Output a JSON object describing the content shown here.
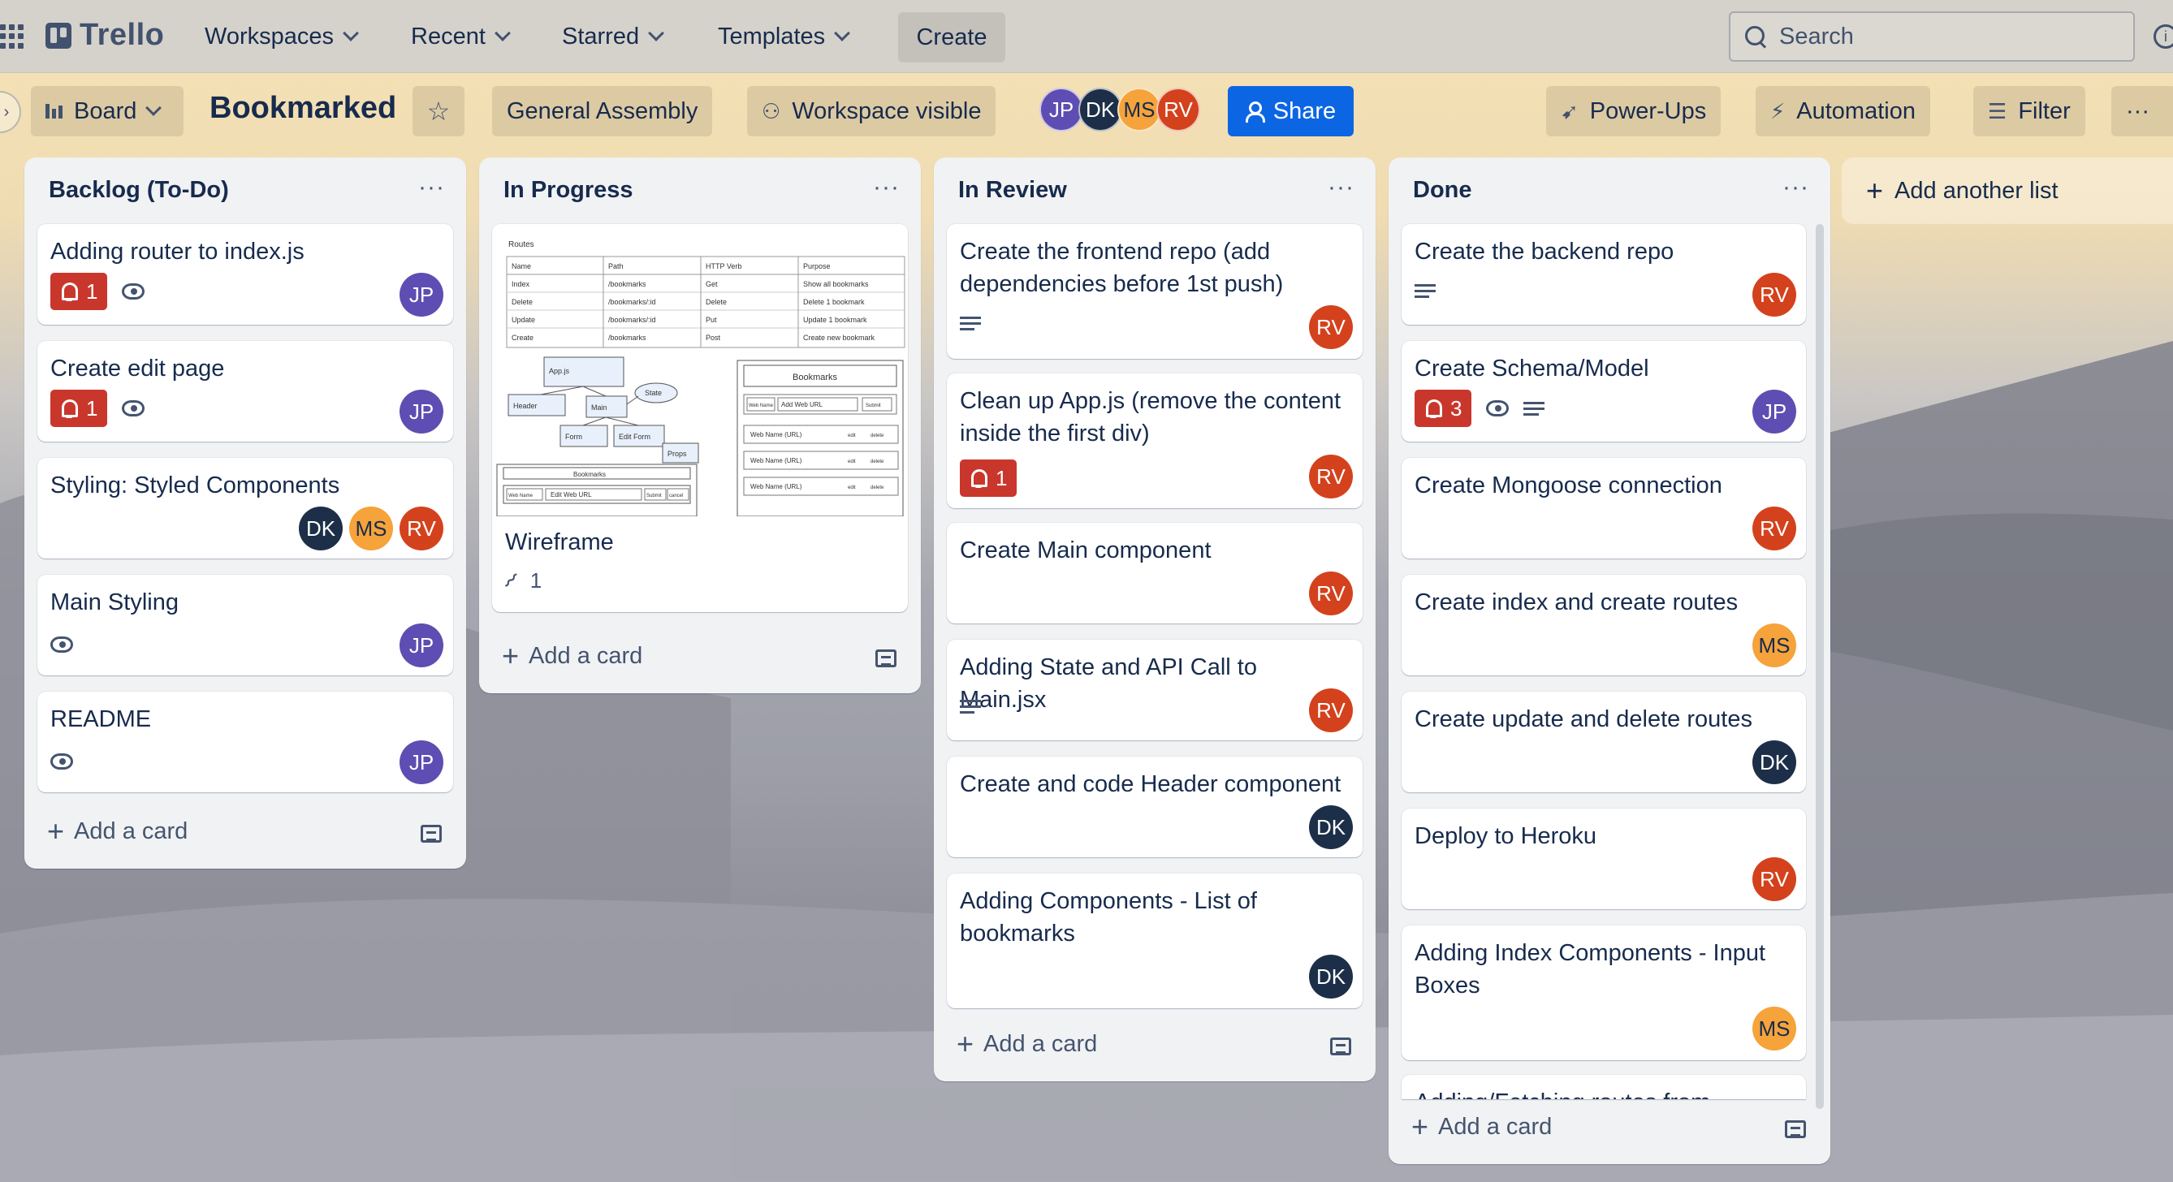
{
  "topnav": {
    "logo": "Trello",
    "items": [
      {
        "label": "Workspaces"
      },
      {
        "label": "Recent"
      },
      {
        "label": "Starred"
      },
      {
        "label": "Templates"
      }
    ],
    "create_label": "Create",
    "search_placeholder": "Search"
  },
  "board": {
    "view_label": "Board",
    "title": "Bookmarked",
    "workspace": "General Assembly",
    "visibility": "Workspace visible",
    "share_label": "Share",
    "powerups_label": "Power-Ups",
    "automation_label": "Automation",
    "filter_label": "Filter",
    "members": [
      "JP",
      "DK",
      "MS",
      "RV"
    ]
  },
  "colors": {
    "JP": "#5e4db2",
    "DK": "#1d2f48",
    "MS": "#f5a33a",
    "RV": "#d3421d",
    "accent": "#0c66e4",
    "alert": "#c9372c"
  },
  "lists": [
    {
      "title": "Backlog (To-Do)",
      "add_label": "Add a card",
      "cards": [
        {
          "title": "Adding router to index.js",
          "alert": "1",
          "watch": true,
          "members": [
            "JP"
          ]
        },
        {
          "title": "Create edit page",
          "alert": "1",
          "watch": true,
          "members": [
            "JP"
          ]
        },
        {
          "title": "Styling: Styled Components",
          "members": [
            "DK",
            "MS",
            "RV"
          ]
        },
        {
          "title": "Main Styling",
          "watch": true,
          "members": [
            "JP"
          ]
        },
        {
          "title": "README",
          "watch": true,
          "members": [
            "JP"
          ]
        }
      ]
    },
    {
      "title": "In Progress",
      "add_label": "Add a card",
      "cards": [
        {
          "title": "Wireframe",
          "attachments": "1",
          "cover": "wireframe"
        }
      ]
    },
    {
      "title": "In Review",
      "add_label": "Add a card",
      "cards": [
        {
          "title": "Create the frontend repo (add dependencies before 1st push)",
          "description": true,
          "members": [
            "RV"
          ]
        },
        {
          "title": "Clean up App.js (remove the content inside the first div)",
          "alert": "1",
          "members": [
            "RV"
          ]
        },
        {
          "title": "Create Main component",
          "members": [
            "RV"
          ]
        },
        {
          "title": "Adding State and API Call to Main.jsx",
          "description": true,
          "members": [
            "RV"
          ]
        },
        {
          "title": "Create and code Header component",
          "members": [
            "DK"
          ]
        },
        {
          "title": "Adding Components - List of bookmarks",
          "members": [
            "DK"
          ]
        }
      ]
    },
    {
      "title": "Done",
      "add_label": "Add a card",
      "cards": [
        {
          "title": "Create the backend repo",
          "description": true,
          "members": [
            "RV"
          ]
        },
        {
          "title": "Create Schema/Model",
          "alert": "3",
          "watch": true,
          "description": true,
          "members": [
            "JP"
          ]
        },
        {
          "title": "Create Mongoose connection",
          "members": [
            "RV"
          ]
        },
        {
          "title": "Create index and create routes",
          "members": [
            "MS"
          ]
        },
        {
          "title": "Create update and delete routes",
          "members": [
            "DK"
          ]
        },
        {
          "title": "Deploy to Heroku",
          "members": [
            "RV"
          ]
        },
        {
          "title": "Adding Index Components - Input Boxes",
          "members": [
            "MS"
          ]
        },
        {
          "title": "Adding/Fetching routes from"
        }
      ]
    }
  ],
  "add_list_label": "Add another list",
  "wireframe": {
    "routes_title": "Routes",
    "headers": [
      "Name",
      "Path",
      "HTTP Verb",
      "Purpose"
    ],
    "rows": [
      [
        "Index",
        "/bookmarks",
        "Get",
        "Show all bookmarks"
      ],
      [
        "Delete",
        "/bookmarks/:id",
        "Delete",
        "Delete 1 bookmark"
      ],
      [
        "Update",
        "/bookmarks/:id",
        "Put",
        "Update 1 bookmark"
      ],
      [
        "Create",
        "/bookmarks",
        "Post",
        "Create new bookmark"
      ]
    ],
    "nodes": [
      "App.js",
      "Header",
      "Main",
      "State",
      "Form",
      "Edit Form",
      "Props"
    ],
    "bookmarks_title": "Bookmarks",
    "web_name": "Web Name",
    "add_url": "Add Web URL",
    "edit_url": "Edit Web URL",
    "web_name_url": "Web Name (URL)",
    "submit": "Submit",
    "cancel": "cancel",
    "edit": "edit",
    "delete": "delete"
  }
}
